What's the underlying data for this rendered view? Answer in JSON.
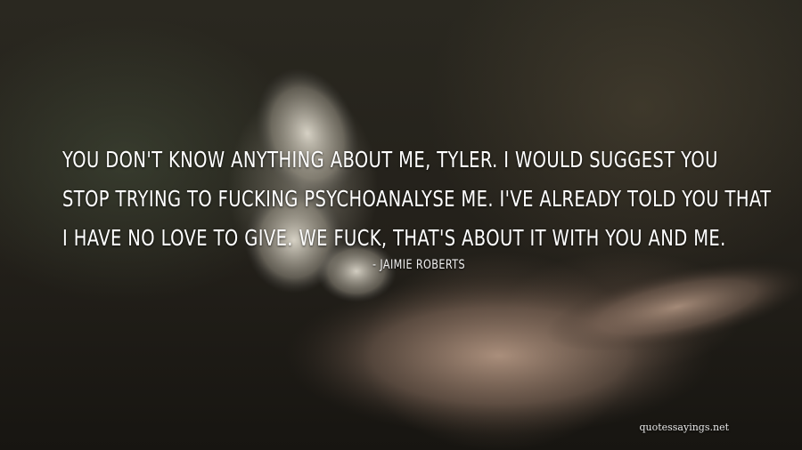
{
  "quote": {
    "lines": [
      "You don't know anything about me, Tyler. I would suggest you",
      "stop trying to fucking psychoanalyse me. I've already told you that",
      "I have no love to give. We fuck, that's about it with you and me."
    ],
    "author": "- Jaimie Roberts"
  },
  "watermark": "quotessayings.net",
  "colors": {
    "text": "#ffffff",
    "background": "#23201a"
  }
}
